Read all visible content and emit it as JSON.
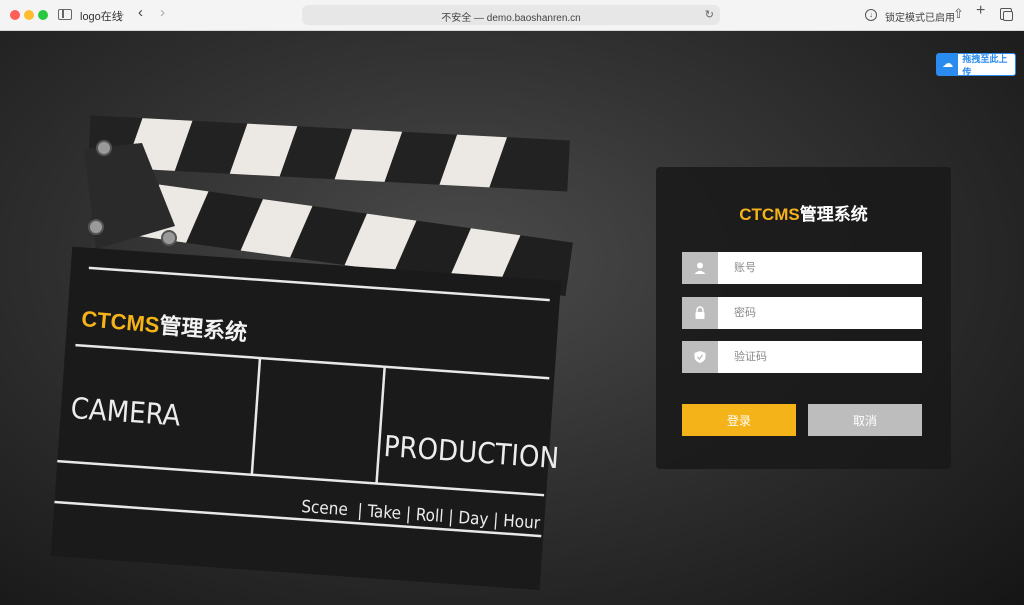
{
  "browser": {
    "tab_title": "logo在线",
    "url": "不安全 — demo.baoshanren.cn",
    "lock_mode_label": "锁定模式已启用"
  },
  "upload": {
    "label": "拖拽至此上传"
  },
  "clapperboard": {
    "brand": "CTCMS",
    "title_suffix": "管理系统",
    "camera": "CAMERA",
    "production": "PRODUCTION",
    "footer": "Scene  | Take | Roll | Day | Hour"
  },
  "login": {
    "brand": "CTCMS",
    "title_suffix": "管理系统",
    "account_placeholder": "账号",
    "password_placeholder": "密码",
    "captcha_placeholder": "验证码",
    "login_button": "登录",
    "cancel_button": "取消"
  },
  "colors": {
    "accent": "#f5b31a",
    "panel_bg": "#191919",
    "upload_blue": "#2b8cf0",
    "cancel_gray": "#bdbdbd"
  }
}
